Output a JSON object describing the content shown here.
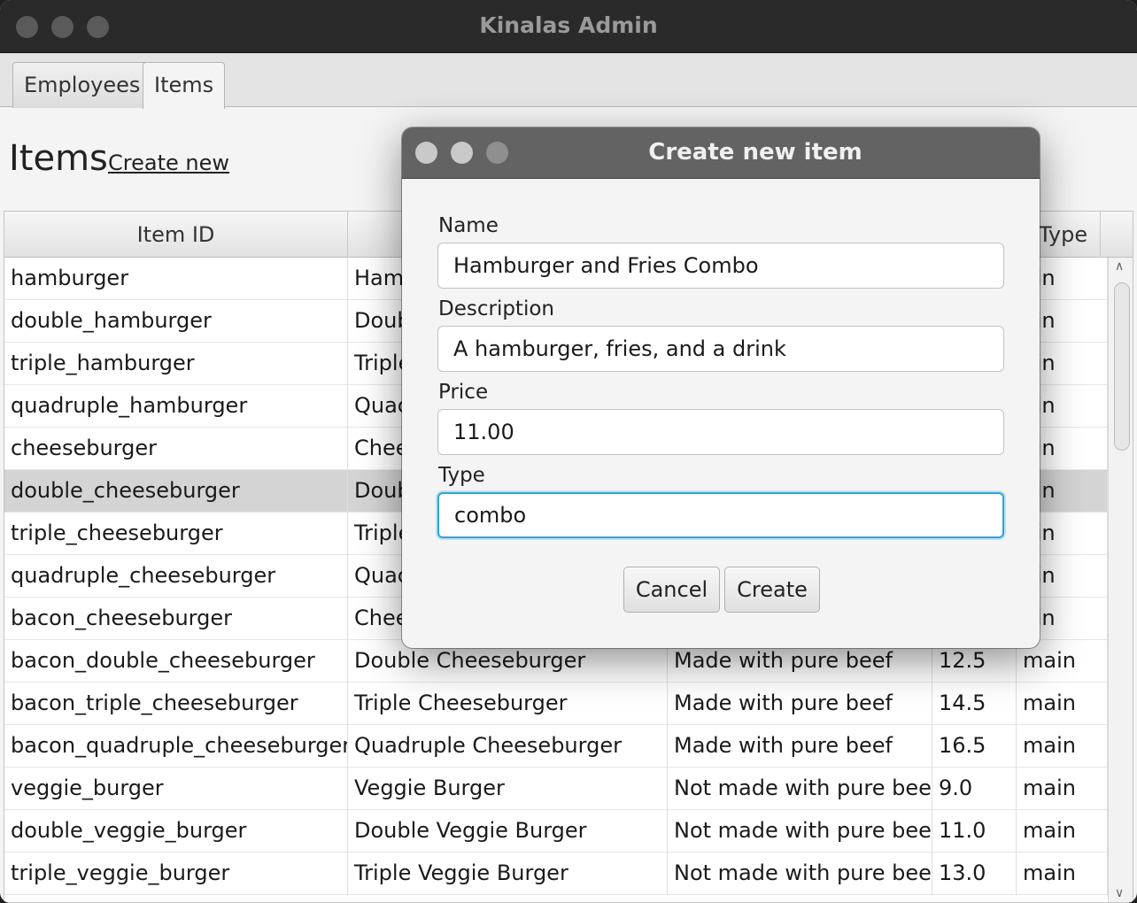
{
  "window": {
    "title": "Kinalas Admin"
  },
  "tabs": [
    {
      "label": "Employees",
      "active": false
    },
    {
      "label": "Items",
      "active": true
    }
  ],
  "page": {
    "heading": "Items",
    "create_link": "Create new"
  },
  "table": {
    "columns": [
      "Item ID",
      "",
      "",
      "",
      "Type"
    ],
    "selected_row": 5,
    "rows": [
      [
        "hamburger",
        "Ham",
        "",
        "",
        "ain"
      ],
      [
        "double_hamburger",
        "Doub",
        "",
        "",
        "ain"
      ],
      [
        "triple_hamburger",
        "Triple",
        "",
        "",
        "ain"
      ],
      [
        "quadruple_hamburger",
        "Quac",
        "",
        "",
        "ain"
      ],
      [
        "cheeseburger",
        "Chee",
        "",
        "",
        "ain"
      ],
      [
        "double_cheeseburger",
        "Doub",
        "",
        "",
        "ain"
      ],
      [
        "triple_cheeseburger",
        "Triple",
        "",
        "",
        "ain"
      ],
      [
        "quadruple_cheeseburger",
        "Quac",
        "",
        "",
        "ain"
      ],
      [
        "bacon_cheeseburger",
        "Chee",
        "",
        "",
        "ain"
      ],
      [
        "bacon_double_cheeseburger",
        "Double Cheeseburger",
        "Made with pure beef",
        "12.5",
        "main"
      ],
      [
        "bacon_triple_cheeseburger",
        "Triple Cheeseburger",
        "Made with pure beef",
        "14.5",
        "main"
      ],
      [
        "bacon_quadruple_cheeseburger",
        "Quadruple Cheeseburger",
        "Made with pure beef",
        "16.5",
        "main"
      ],
      [
        "veggie_burger",
        "Veggie Burger",
        "Not made with pure beef",
        "9.0",
        "main"
      ],
      [
        "double_veggie_burger",
        "Double Veggie Burger",
        "Not made with pure beef",
        "11.0",
        "main"
      ],
      [
        "triple_veggie_burger",
        "Triple Veggie Burger",
        "Not made with pure beef",
        "13.0",
        "main"
      ]
    ]
  },
  "dialog": {
    "title": "Create new item",
    "fields": {
      "name": {
        "label": "Name",
        "value": "Hamburger and Fries Combo"
      },
      "description": {
        "label": "Description",
        "value": "A hamburger, fries, and a drink"
      },
      "price": {
        "label": "Price",
        "value": "11.00"
      },
      "type": {
        "label": "Type",
        "value": "combo"
      }
    },
    "cancel_label": "Cancel",
    "create_label": "Create"
  },
  "colors": {
    "focus_ring": "#2ba4dd",
    "selected_row": "#d4d4d4",
    "dialog_titlebar": "#636363",
    "window_titlebar": "#2a2a2a"
  }
}
